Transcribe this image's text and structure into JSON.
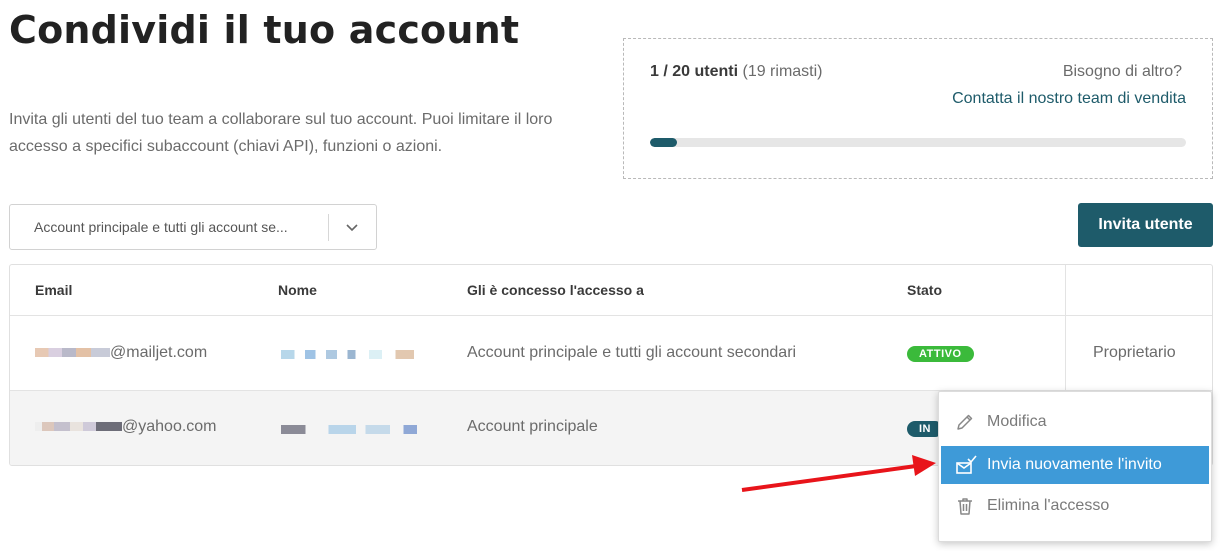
{
  "page": {
    "title": "Condividi il tuo account",
    "description": "Invita gli utenti del tuo team a collaborare sul tuo account. Puoi limitare il loro accesso a specifici subaccount (chiavi API), funzioni o azioni."
  },
  "quota": {
    "count": "1 / 20 utenti",
    "remaining": "(19 rimasti)",
    "need_more": "Bisogno di altro?",
    "contact_link": "Contatta il nostro team di vendita",
    "progress_fraction": 0.05
  },
  "filter": {
    "selected": "Account principale e tutti gli account se..."
  },
  "toolbar": {
    "invite_label": "Invita utente"
  },
  "table": {
    "headers": {
      "email": "Email",
      "name": "Nome",
      "access": "Gli è concesso l'accesso a",
      "status": "Stato"
    },
    "rows": [
      {
        "email_domain": "@mailjet.com",
        "access": "Account principale e tutti gli account secondari",
        "status": "ATTIVO",
        "role": "Proprietario"
      },
      {
        "email_domain": "@yahoo.com",
        "access": "Account principale",
        "status": "IN"
      }
    ]
  },
  "context_menu": {
    "items": [
      {
        "label": "Modifica",
        "icon": "pencil-icon"
      },
      {
        "label": "Invia nuovamente l'invito",
        "icon": "resend-mail-icon"
      },
      {
        "label": "Elimina l'accesso",
        "icon": "trash-icon"
      }
    ]
  },
  "colors": {
    "brand": "#1e5b6a",
    "active": "#3bba3b",
    "highlight": "#3e9ad8",
    "annotation_arrow": "#e8141a"
  }
}
